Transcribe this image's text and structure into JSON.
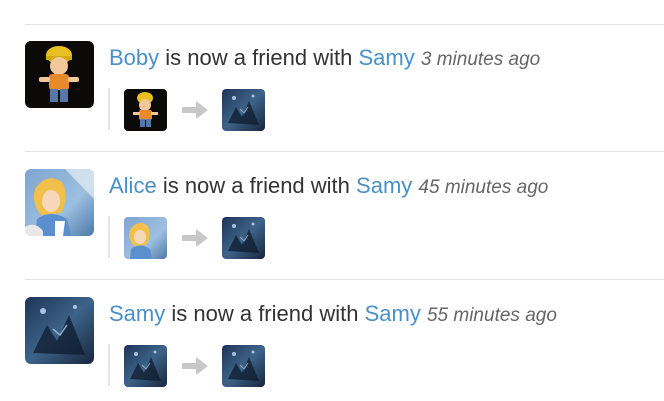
{
  "activity_feed": {
    "items": [
      {
        "actor": "Boby",
        "actor_avatar": "bob-builder-toy-icon",
        "verb": "is now a friend with",
        "target": "Samy",
        "target_avatar": "dark-blue-night-scene-icon",
        "time": "3 minutes ago"
      },
      {
        "actor": "Alice",
        "actor_avatar": "alice-cartoon-icon",
        "verb": "is now a friend with",
        "target": "Samy",
        "target_avatar": "dark-blue-night-scene-icon",
        "time": "45 minutes ago"
      },
      {
        "actor": "Samy",
        "actor_avatar": "dark-blue-night-scene-icon",
        "verb": "is now a friend with",
        "target": "Samy",
        "target_avatar": "dark-blue-night-scene-icon",
        "time": "55 minutes ago"
      }
    ],
    "arrow_icon": "arrow-right-icon",
    "colors": {
      "link": "#4a90c8",
      "text": "#333333",
      "timestamp": "#666666",
      "divider": "#e3e3e3",
      "arrow": "#c8c8c8"
    }
  }
}
